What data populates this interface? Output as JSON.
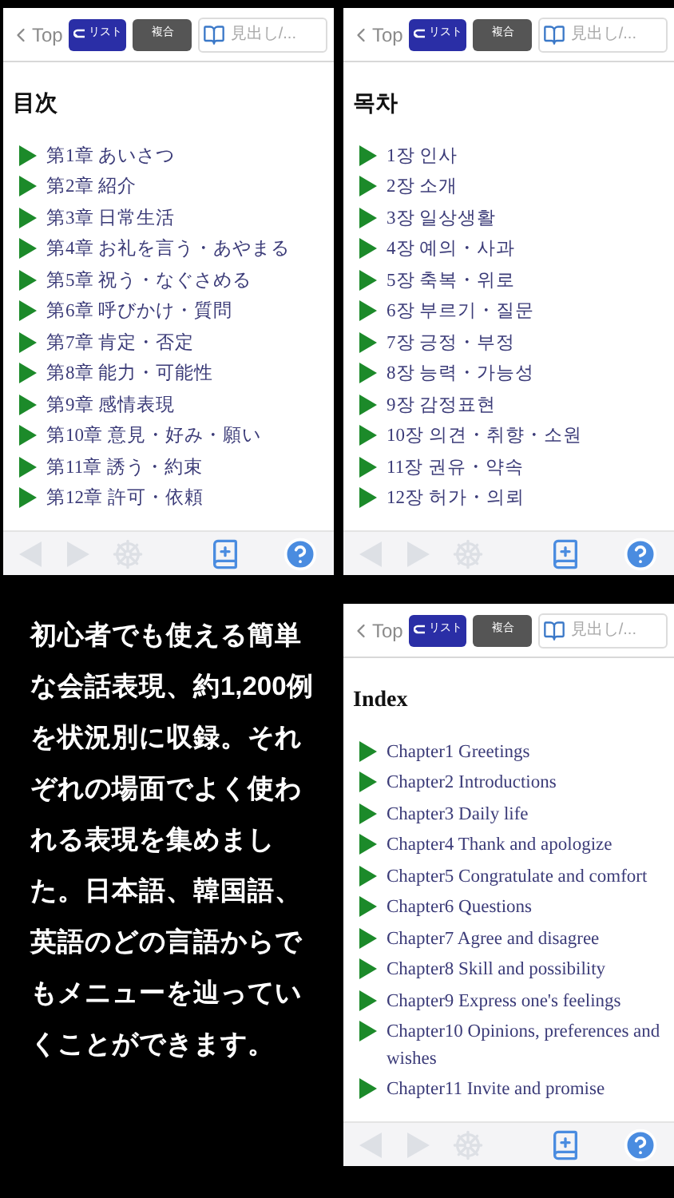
{
  "screens": [
    {
      "header": {
        "back": "Top",
        "list_button": "リスト",
        "combo_button": "複合",
        "search": {
          "placeholder": "見出し/..."
        }
      },
      "title": "目次",
      "items": [
        "第1章 あいさつ",
        "第2章 紹介",
        "第3章 日常生活",
        "第4章 お礼を言う・あやまる",
        "第5章 祝う・なぐさめる",
        "第6章 呼びかけ・質問",
        "第7章 肯定・否定",
        "第8章 能力・可能性",
        "第9章 感情表現",
        "第10章 意見・好み・願い",
        "第11章 誘う・約束",
        "第12章 許可・依頼"
      ],
      "toolbar": [
        {
          "kind": "back",
          "disabled": true
        },
        {
          "kind": "forward",
          "disabled": true
        },
        {
          "kind": "wheel",
          "disabled": true
        },
        {
          "kind": "bookmark",
          "disabled": false
        },
        {
          "kind": "help",
          "disabled": false
        }
      ]
    },
    {
      "header": {
        "back": "Top",
        "list_button": "リスト",
        "combo_button": "複合",
        "search": {
          "placeholder": "見出し/..."
        }
      },
      "title": "목차",
      "items": [
        "1장 인사",
        "2장 소개",
        "3장 일상생활",
        "4장 예의・사과",
        "5장 축복・위로",
        "6장 부르기・질문",
        "7장 긍정・부정",
        "8장 능력・가능성",
        "9장 감정표현",
        "10장 의견・취향・소원",
        "11장 권유・약속",
        "12장 허가・의뢰"
      ],
      "toolbar": [
        {
          "kind": "back",
          "disabled": true
        },
        {
          "kind": "forward",
          "disabled": true
        },
        {
          "kind": "wheel",
          "disabled": true
        },
        {
          "kind": "bookmark",
          "disabled": false
        },
        {
          "kind": "help",
          "disabled": false
        }
      ]
    },
    {
      "header": {
        "back": "Top",
        "list_button": "リスト",
        "combo_button": "複合",
        "search": {
          "placeholder": "見出し/..."
        }
      },
      "title": "Index",
      "items": [
        "Chapter1 Greetings",
        "Chapter2 Introductions",
        "Chapter3 Daily life",
        "Chapter4 Thank and apologize",
        "Chapter5 Congratulate and comfort",
        "Chapter6 Questions",
        "Chapter7 Agree and disagree",
        "Chapter8 Skill and possibility",
        "Chapter9 Express one's feelings",
        "Chapter10 Opinions, preferences and wishes",
        "Chapter11 Invite and promise"
      ],
      "toolbar": [
        {
          "kind": "back",
          "disabled": true
        },
        {
          "kind": "forward",
          "disabled": true
        },
        {
          "kind": "wheel",
          "disabled": true
        },
        {
          "kind": "bookmark",
          "disabled": false
        },
        {
          "kind": "help",
          "disabled": false
        }
      ]
    }
  ],
  "description": "初心者でも使える簡単な会話表現、約1,200例を状況別に収録。それぞれの場面でよく使われる表現を集めました。日本語、韓国語、英語のどの言語からでもメニューを辿っていくことができます。"
}
